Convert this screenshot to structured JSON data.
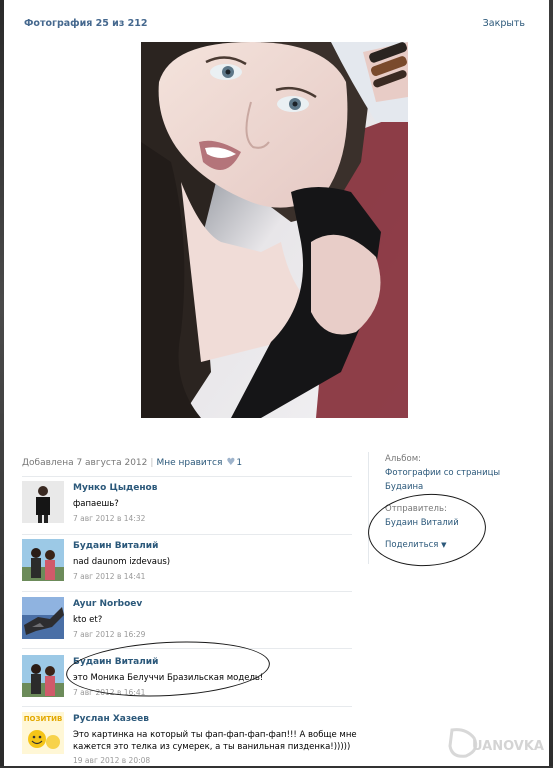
{
  "header": {
    "title": "Фотография 25 из 212",
    "close_label": "Закрыть"
  },
  "photo_meta": {
    "added": "Добавлена 7 августа 2012",
    "like_label": "Мне нравится",
    "like_count": "1"
  },
  "sidebar": {
    "album_label": "Альбом:",
    "album_line1": "Фотографии со страницы",
    "album_line2": "Будаина",
    "sender_label": "Отправитель:",
    "sender_name": "Будаин Виталий",
    "share_label": "Поделиться"
  },
  "comments": [
    {
      "author": "Мунко Цыденов",
      "text": "фапаешь?",
      "date": "7 авг 2012 в 14:32"
    },
    {
      "author": "Будаин Виталий",
      "text": "nad daunom izdevaus)",
      "date": "7 авг 2012 в 14:41"
    },
    {
      "author": "Ayur Norboev",
      "text": "kto et?",
      "date": "7 авг 2012 в 16:29"
    },
    {
      "author": "Будаин Виталий",
      "text": "это Моника Белуччи Бразильская модель!",
      "date": "7 авг 2012 в 16:41"
    },
    {
      "author": "Руслан Хазеев",
      "text": "Это картинка на который ты фап-фап-фап-фап!!! А вобще мне кажется это телка из сумерек, а ты ванильная пизденка!)))))",
      "date": "19 авг 2012 в 20:08"
    }
  ],
  "avatars": {
    "positive_label": "ПОЗИТИВ"
  },
  "watermark": "UANOVKA"
}
